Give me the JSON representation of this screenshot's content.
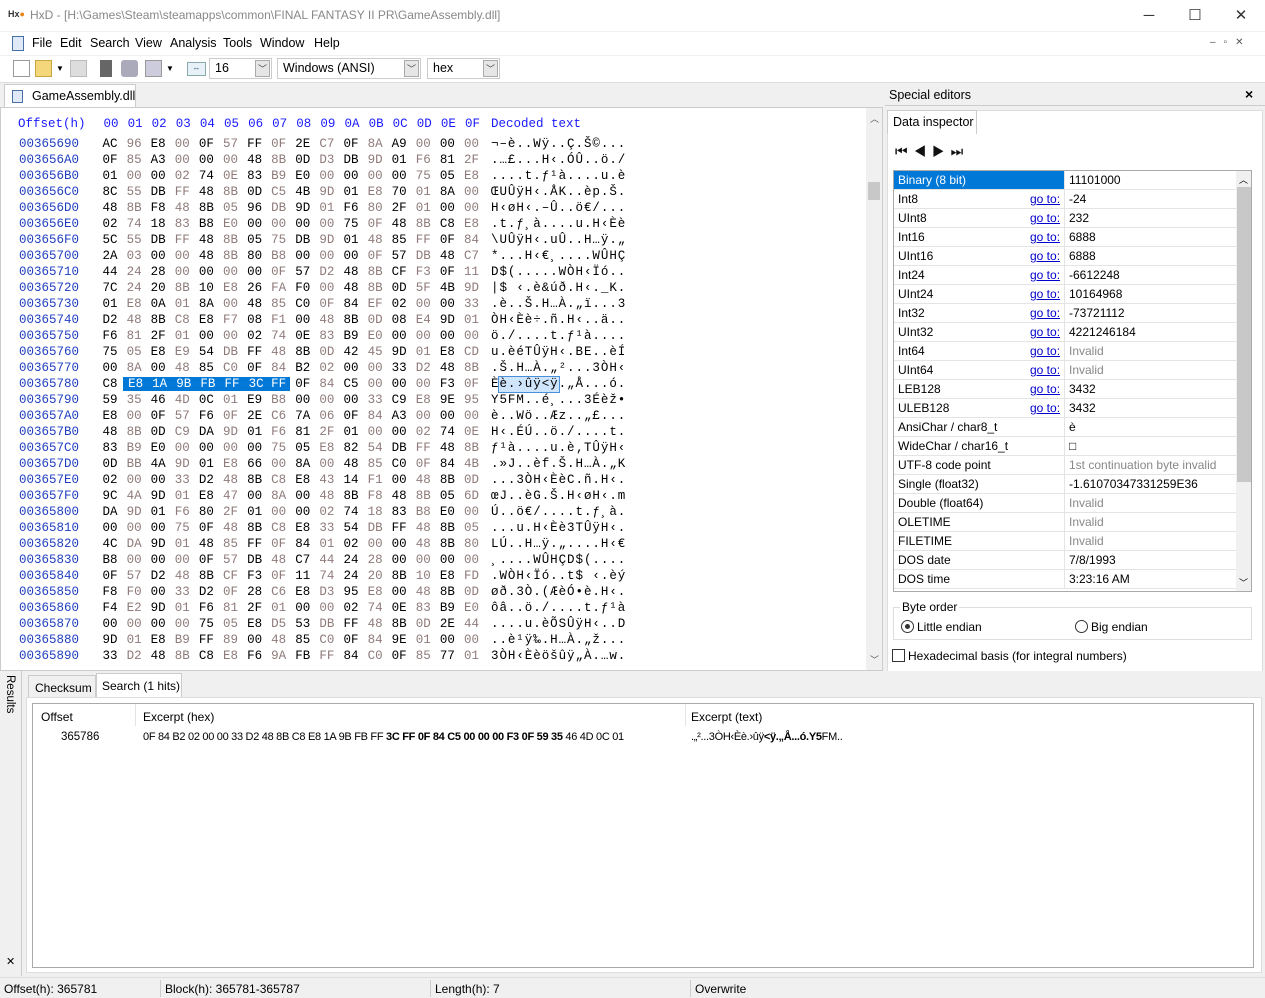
{
  "window": {
    "title": "HxD - [H:\\Games\\Steam\\steamapps\\common\\FINAL FANTASY II PR\\GameAssembly.dll]",
    "minimize": "─",
    "maximize": "☐",
    "close": "✕"
  },
  "menu": [
    "File",
    "Edit",
    "Search",
    "View",
    "Analysis",
    "Tools",
    "Window",
    "Help"
  ],
  "toolbar": {
    "bytes_per_row": "16",
    "charset": "Windows (ANSI)",
    "base": "hex"
  },
  "doc_tab": "GameAssembly.dll",
  "hex": {
    "offset_header": "Offset(h)",
    "columns": [
      "00",
      "01",
      "02",
      "03",
      "04",
      "05",
      "06",
      "07",
      "08",
      "09",
      "0A",
      "0B",
      "0C",
      "0D",
      "0E",
      "0F"
    ],
    "decoded_header": "Decoded text",
    "selection": {
      "row": "00365780",
      "start": 1,
      "end": 7
    },
    "rows": [
      {
        "offset": "00365690",
        "bytes": "AC 96 E8 00 0F 57 FF 0F 2E C7 0F 8A A9 00 00 00",
        "text": "¬–è..Wÿ..Ç.Š©..."
      },
      {
        "offset": "003656A0",
        "bytes": "0F 85 A3 00 00 00 48 8B 0D D3 DB 9D 01 F6 81 2F",
        "text": ".…£...H‹.ÓÛ..ö./"
      },
      {
        "offset": "003656B0",
        "bytes": "01 00 00 02 74 0E 83 B9 E0 00 00 00 00 75 05 E8",
        "text": "....t.ƒ¹à....u.è"
      },
      {
        "offset": "003656C0",
        "bytes": "8C 55 DB FF 48 8B 0D C5 4B 9D 01 E8 70 01 8A 00",
        "text": "ŒUÛÿH‹.ÅK..èp.Š."
      },
      {
        "offset": "003656D0",
        "bytes": "48 8B F8 48 8B 05 96 DB 9D 01 F6 80 2F 01 00 00",
        "text": "H‹øH‹.–Û..ö€/..."
      },
      {
        "offset": "003656E0",
        "bytes": "02 74 18 83 B8 E0 00 00 00 00 75 0F 48 8B C8 E8",
        "text": ".t.ƒ¸à....u.H‹Èè"
      },
      {
        "offset": "003656F0",
        "bytes": "5C 55 DB FF 48 8B 05 75 DB 9D 01 48 85 FF 0F 84",
        "text": "\\UÛÿH‹.uÛ..H…ÿ.„"
      },
      {
        "offset": "00365700",
        "bytes": "2A 03 00 00 48 8B 80 B8 00 00 00 0F 57 DB 48 C7",
        "text": "*...H‹€¸....WÛHÇ"
      },
      {
        "offset": "00365710",
        "bytes": "44 24 28 00 00 00 00 0F 57 D2 48 8B CF F3 0F 11",
        "text": "D$(.....WÒH‹Ïó.."
      },
      {
        "offset": "00365720",
        "bytes": "7C 24 20 8B 10 E8 26 FA F0 00 48 8B 0D 5F 4B 9D",
        "text": "|$ ‹.è&úð.H‹._K."
      },
      {
        "offset": "00365730",
        "bytes": "01 E8 0A 01 8A 00 48 85 C0 0F 84 EF 02 00 00 33",
        "text": ".è..Š.H…À.„ï...3"
      },
      {
        "offset": "00365740",
        "bytes": "D2 48 8B C8 E8 F7 08 F1 00 48 8B 0D 08 E4 9D 01",
        "text": "ÒH‹Èè÷.ñ.H‹..ä.."
      },
      {
        "offset": "00365750",
        "bytes": "F6 81 2F 01 00 00 02 74 0E 83 B9 E0 00 00 00 00",
        "text": "ö./....t.ƒ¹à...."
      },
      {
        "offset": "00365760",
        "bytes": "75 05 E8 E9 54 DB FF 48 8B 0D 42 45 9D 01 E8 CD",
        "text": "u.èéTÛÿH‹.BE..èÍ"
      },
      {
        "offset": "00365770",
        "bytes": "00 8A 00 48 85 C0 0F 84 B2 02 00 00 33 D2 48 8B",
        "text": ".Š.H…À.„²...3ÒH‹"
      },
      {
        "offset": "00365780",
        "bytes": "C8 E8 1A 9B FB FF 3C FF 0F 84 C5 00 00 00 F3 0F",
        "text": "Èè.›ûÿ<ÿ.„Å...ó."
      },
      {
        "offset": "00365790",
        "bytes": "59 35 46 4D 0C 01 E9 B8 00 00 00 33 C9 E8 9E 95",
        "text": "Y5FM..é¸...3Éèž•"
      },
      {
        "offset": "003657A0",
        "bytes": "E8 00 0F 57 F6 0F 2E C6 7A 06 0F 84 A3 00 00 00",
        "text": "è..Wö..Æz..„£..."
      },
      {
        "offset": "003657B0",
        "bytes": "48 8B 0D C9 DA 9D 01 F6 81 2F 01 00 00 02 74 0E",
        "text": "H‹.ÉÚ..ö./....t."
      },
      {
        "offset": "003657C0",
        "bytes": "83 B9 E0 00 00 00 00 75 05 E8 82 54 DB FF 48 8B",
        "text": "ƒ¹à....u.è‚TÛÿH‹"
      },
      {
        "offset": "003657D0",
        "bytes": "0D BB 4A 9D 01 E8 66 00 8A 00 48 85 C0 0F 84 4B",
        "text": ".»J..èf.Š.H…À.„K"
      },
      {
        "offset": "003657E0",
        "bytes": "02 00 00 33 D2 48 8B C8 E8 43 14 F1 00 48 8B 0D",
        "text": "...3ÒH‹ÈèC.ñ.H‹."
      },
      {
        "offset": "003657F0",
        "bytes": "9C 4A 9D 01 E8 47 00 8A 00 48 8B F8 48 8B 05 6D",
        "text": "œJ..èG.Š.H‹øH‹.m"
      },
      {
        "offset": "00365800",
        "bytes": "DA 9D 01 F6 80 2F 01 00 00 02 74 18 83 B8 E0 00",
        "text": "Ú..ö€/....t.ƒ¸à."
      },
      {
        "offset": "00365810",
        "bytes": "00 00 00 75 0F 48 8B C8 E8 33 54 DB FF 48 8B 05",
        "text": "...u.H‹Èè3TÛÿH‹."
      },
      {
        "offset": "00365820",
        "bytes": "4C DA 9D 01 48 85 FF 0F 84 01 02 00 00 48 8B 80",
        "text": "LÚ..H…ÿ.„....H‹€"
      },
      {
        "offset": "00365830",
        "bytes": "B8 00 00 00 0F 57 DB 48 C7 44 24 28 00 00 00 00",
        "text": "¸....WÛHÇD$(...."
      },
      {
        "offset": "00365840",
        "bytes": "0F 57 D2 48 8B CF F3 0F 11 74 24 20 8B 10 E8 FD",
        "text": ".WÒH‹Ïó..t$ ‹.èý"
      },
      {
        "offset": "00365850",
        "bytes": "F8 F0 00 33 D2 0F 28 C6 E8 D3 95 E8 00 48 8B 0D",
        "text": "øð.3Ò.(ÆèÓ•è.H‹."
      },
      {
        "offset": "00365860",
        "bytes": "F4 E2 9D 01 F6 81 2F 01 00 00 02 74 0E 83 B9 E0",
        "text": "ôâ..ö./....t.ƒ¹à"
      },
      {
        "offset": "00365870",
        "bytes": "00 00 00 00 75 05 E8 D5 53 DB FF 48 8B 0D 2E 44",
        "text": "....u.èÕSÛÿH‹..D"
      },
      {
        "offset": "00365880",
        "bytes": "9D 01 E8 B9 FF 89 00 48 85 C0 0F 84 9E 01 00 00",
        "text": "..è¹ÿ‰.H…À.„ž..."
      },
      {
        "offset": "00365890",
        "bytes": "33 D2 48 8B C8 E8 F6 9A FB FF 84 C0 0F 85 77 01",
        "text": "3ÒH‹Èèöšûÿ„À.…w."
      }
    ]
  },
  "special_editors": {
    "title": "Special editors",
    "close": "×",
    "tab": "Data inspector",
    "goto_label": "go to:",
    "rows": [
      {
        "label": "Binary (8 bit)",
        "value": "11101000",
        "goto": false,
        "selected": true
      },
      {
        "label": "Int8",
        "value": "-24",
        "goto": true
      },
      {
        "label": "UInt8",
        "value": "232",
        "goto": true
      },
      {
        "label": "Int16",
        "value": "6888",
        "goto": true
      },
      {
        "label": "UInt16",
        "value": "6888",
        "goto": true
      },
      {
        "label": "Int24",
        "value": "-6612248",
        "goto": true
      },
      {
        "label": "UInt24",
        "value": "10164968",
        "goto": true
      },
      {
        "label": "Int32",
        "value": "-73721112",
        "goto": true
      },
      {
        "label": "UInt32",
        "value": "4221246184",
        "goto": true
      },
      {
        "label": "Int64",
        "value": "Invalid",
        "goto": true,
        "invalid": true
      },
      {
        "label": "UInt64",
        "value": "Invalid",
        "goto": true,
        "invalid": true
      },
      {
        "label": "LEB128",
        "value": "3432",
        "goto": true
      },
      {
        "label": "ULEB128",
        "value": "3432",
        "goto": true
      },
      {
        "label": "AnsiChar / char8_t",
        "value": "è",
        "goto": false
      },
      {
        "label": "WideChar / char16_t",
        "value": "□",
        "goto": false
      },
      {
        "label": "UTF-8 code point",
        "value": "1st continuation byte invalid",
        "goto": false,
        "invalid": true
      },
      {
        "label": "Single (float32)",
        "value": "-1.61070347331259E36",
        "goto": false
      },
      {
        "label": "Double (float64)",
        "value": "Invalid",
        "goto": false,
        "invalid": true
      },
      {
        "label": "OLETIME",
        "value": "Invalid",
        "goto": false,
        "invalid": true
      },
      {
        "label": "FILETIME",
        "value": "Invalid",
        "goto": false,
        "invalid": true
      },
      {
        "label": "DOS date",
        "value": "7/8/1993",
        "goto": false
      },
      {
        "label": "DOS time",
        "value": "3:23:16 AM",
        "goto": false
      }
    ],
    "byte_order": {
      "label": "Byte order",
      "little": "Little endian",
      "big": "Big endian",
      "selected": "little"
    },
    "hex_basis": {
      "label": "Hexadecimal basis (for integral numbers)",
      "checked": false
    }
  },
  "results": {
    "side_label": "Results",
    "close": "✕",
    "tabs": [
      "Checksum",
      "Search (1 hits)"
    ],
    "active_tab": 1,
    "headers": [
      "Offset",
      "Excerpt (hex)",
      "Excerpt (text)"
    ],
    "hit": {
      "offset": "365786",
      "hex_pre": "0F 84 B2 02 00 00 33 D2 48 8B C8 E8 1A 9B FB FF ",
      "hex_match": "3C FF 0F 84 C5 00 00 00 F3 0F 59 35",
      "hex_post": " 46 4D 0C 01",
      "text_pre": ".„²...3ÒH‹Èè.›ûÿ",
      "text_match": "<ÿ.„Å...ó.Y5",
      "text_post": "FM.."
    }
  },
  "status": {
    "offset": "Offset(h): 365781",
    "block": "Block(h): 365781-365787",
    "length": "Length(h): 7",
    "mode": "Overwrite"
  },
  "colors": {
    "selection": "#0078d7",
    "offset_blue": "#1f3fbf",
    "header_blue": "#1a1aff",
    "odd_byte": "#8f7a7a"
  }
}
